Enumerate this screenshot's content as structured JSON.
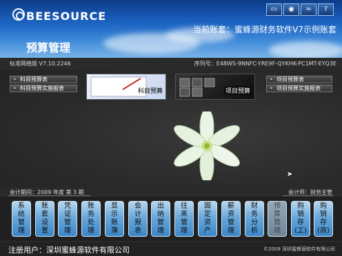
{
  "header": {
    "brand": "BEESOURCE",
    "account_label": "当前账套：蜜蜂源财务软件V7示例账套",
    "module_title": "预算管理",
    "top_icons": [
      "window-icon",
      "eye-icon",
      "wave-icon",
      "help-icon"
    ]
  },
  "info": {
    "version": "标准网络版 V7.10.2246",
    "serial": "序列号：E48WS-9NNFC-YRE9F-QYKHK-PC1MT-EYQ3E"
  },
  "left_buttons": [
    {
      "label": "科目预算表"
    },
    {
      "label": "科目预算实施报表"
    }
  ],
  "right_buttons": [
    {
      "label": "项目预算表"
    },
    {
      "label": "项目预算实施报表"
    }
  ],
  "cards": [
    {
      "label": "科目预算"
    },
    {
      "label": "项目预算"
    }
  ],
  "status": {
    "period": "会计期间：2009 年度 第 3 期",
    "accountant": "会计师：财务主管"
  },
  "toolbar": [
    {
      "label": "系统管理",
      "enabled": true
    },
    {
      "label": "账套设置",
      "enabled": true
    },
    {
      "label": "凭证管理",
      "enabled": true
    },
    {
      "label": "账务处理",
      "enabled": true
    },
    {
      "label": "显示账簿",
      "enabled": true
    },
    {
      "label": "会计报表",
      "enabled": true
    },
    {
      "label": "出纳管理",
      "enabled": true
    },
    {
      "label": "往来管理",
      "enabled": true
    },
    {
      "label": "固定资产",
      "enabled": true
    },
    {
      "label": "薪资管理",
      "enabled": true
    },
    {
      "label": "财务分析",
      "enabled": true
    },
    {
      "label": "预算管理",
      "enabled": false
    },
    {
      "label": "购销存(工)",
      "enabled": true
    },
    {
      "label": "购销存(商)",
      "enabled": true
    }
  ],
  "footer": {
    "registered_user": "注册用户：深圳蜜蜂源软件有限公司",
    "copyright": "©2009 深圳蜜蜂源软件有限公司"
  }
}
